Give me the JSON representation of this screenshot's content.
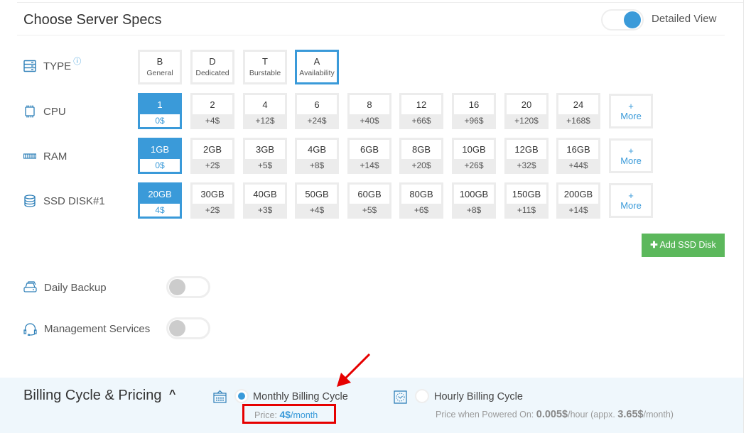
{
  "header": {
    "title": "Choose Server Specs",
    "detailed_view_label": "Detailed View",
    "detailed_view_on": true
  },
  "type": {
    "label": "TYPE",
    "info_icon": "info-icon",
    "options": [
      {
        "code": "B",
        "name": "General",
        "selected": false
      },
      {
        "code": "D",
        "name": "Dedicated",
        "selected": false
      },
      {
        "code": "T",
        "name": "Burstable",
        "selected": false
      },
      {
        "code": "A",
        "name": "Availability",
        "selected": true
      }
    ]
  },
  "cpu": {
    "label": "CPU",
    "options": [
      {
        "value": "1",
        "price": "0$",
        "selected": true
      },
      {
        "value": "2",
        "price": "+4$"
      },
      {
        "value": "4",
        "price": "+12$"
      },
      {
        "value": "6",
        "price": "+24$"
      },
      {
        "value": "8",
        "price": "+40$"
      },
      {
        "value": "12",
        "price": "+66$"
      },
      {
        "value": "16",
        "price": "+96$"
      },
      {
        "value": "20",
        "price": "+120$"
      },
      {
        "value": "24",
        "price": "+168$"
      }
    ],
    "more_label": [
      "+",
      "More"
    ]
  },
  "ram": {
    "label": "RAM",
    "options": [
      {
        "value": "1GB",
        "price": "0$",
        "selected": true
      },
      {
        "value": "2GB",
        "price": "+2$"
      },
      {
        "value": "3GB",
        "price": "+5$"
      },
      {
        "value": "4GB",
        "price": "+8$"
      },
      {
        "value": "6GB",
        "price": "+14$"
      },
      {
        "value": "8GB",
        "price": "+20$"
      },
      {
        "value": "10GB",
        "price": "+26$"
      },
      {
        "value": "12GB",
        "price": "+32$"
      },
      {
        "value": "16GB",
        "price": "+44$"
      }
    ],
    "more_label": [
      "+",
      "More"
    ]
  },
  "ssd": {
    "label": "SSD DISK#1",
    "options": [
      {
        "value": "20GB",
        "price": "4$",
        "selected": true
      },
      {
        "value": "30GB",
        "price": "+2$"
      },
      {
        "value": "40GB",
        "price": "+3$"
      },
      {
        "value": "50GB",
        "price": "+4$"
      },
      {
        "value": "60GB",
        "price": "+5$"
      },
      {
        "value": "80GB",
        "price": "+6$"
      },
      {
        "value": "100GB",
        "price": "+8$"
      },
      {
        "value": "150GB",
        "price": "+11$"
      },
      {
        "value": "200GB",
        "price": "+14$"
      }
    ],
    "more_label": [
      "+",
      "More"
    ],
    "add_button": "Add SSD Disk"
  },
  "services": {
    "daily_backup": {
      "label": "Daily Backup",
      "on": false
    },
    "management": {
      "label": "Management Services",
      "on": false
    }
  },
  "billing": {
    "title": "Billing Cycle & Pricing",
    "monthly": {
      "label": "Monthly Billing Cycle",
      "selected": true,
      "price_prefix": "Price: ",
      "price": "4$",
      "unit": "/month"
    },
    "hourly": {
      "label": "Hourly Billing Cycle",
      "selected": false,
      "price_prefix": "Price when Powered On: ",
      "price": "0.005$",
      "unit": "/hour (appx. ",
      "approx": "3.65$",
      "approx_unit": "/month)"
    }
  },
  "annotation": {
    "highlight_color": "#e60000"
  },
  "colors": {
    "accent": "#3a9ad9",
    "success": "#5cb85c",
    "billing_bg": "#eff7fc"
  }
}
